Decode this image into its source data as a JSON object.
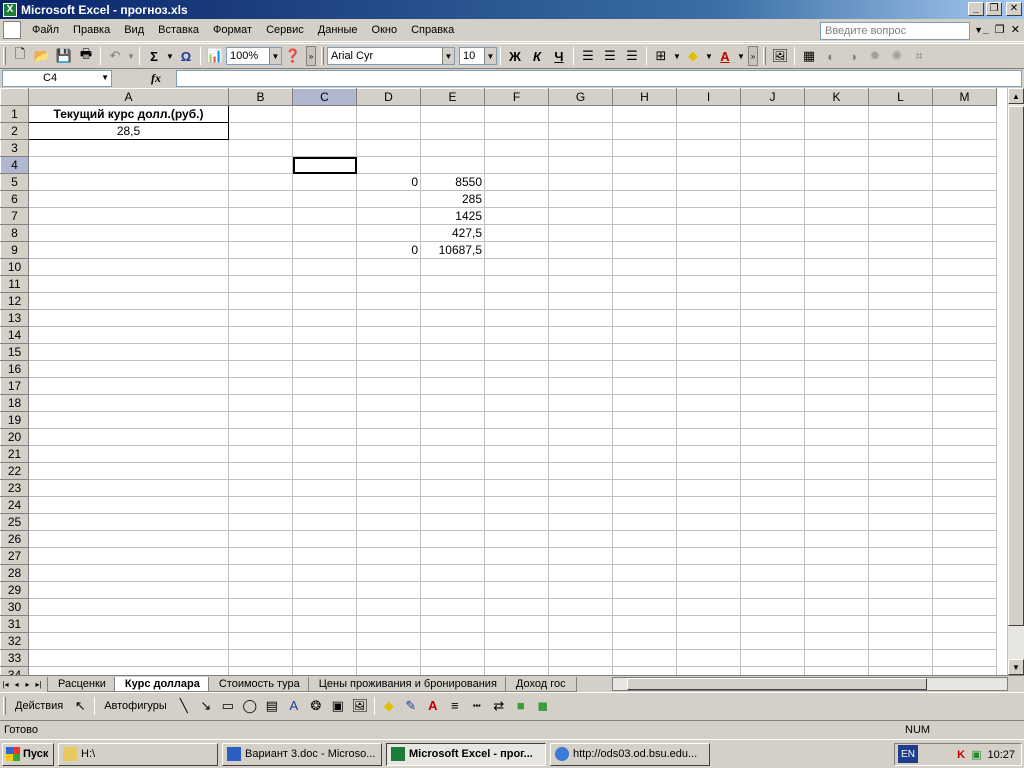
{
  "window": {
    "title": "Microsoft Excel - прогноз.xls",
    "app_icon": "excel-icon"
  },
  "menu": {
    "items": [
      "Файл",
      "Правка",
      "Вид",
      "Вставка",
      "Формат",
      "Сервис",
      "Данные",
      "Окно",
      "Справка"
    ],
    "ask_placeholder": "Введите вопрос"
  },
  "toolbar": {
    "zoom": "100%",
    "font_name": "Arial Cyr",
    "font_size": "10",
    "bold": "Ж",
    "italic": "К",
    "underline": "Ч",
    "sum": "Σ",
    "omega": "Ω"
  },
  "formula_bar": {
    "name_box": "C4",
    "fx": "fx",
    "formula": ""
  },
  "grid": {
    "columns": [
      "A",
      "B",
      "C",
      "D",
      "E",
      "F",
      "G",
      "H",
      "I",
      "J",
      "K",
      "L",
      "M"
    ],
    "selected_column": "C",
    "selected_row": 4,
    "rows": 34,
    "cells": {
      "A1": "Текущий курс долл.(руб.)",
      "A2": "28,5",
      "D5": "0",
      "E5": "8550",
      "E6": "285",
      "E7": "1425",
      "E8": "427,5",
      "D9": "0",
      "E9": "10687,5"
    }
  },
  "sheets": {
    "tabs": [
      "Расценки",
      "Курс доллара",
      "Стоимость тура",
      "Цены проживания и бронирования",
      "Доход гос"
    ],
    "active": 1
  },
  "drawing_toolbar": {
    "actions": "Действия",
    "autoshapes": "Автофигуры"
  },
  "status": {
    "ready": "Готово",
    "num": "NUM"
  },
  "taskbar": {
    "start": "Пуск",
    "buttons": [
      {
        "label": "H:\\",
        "active": false
      },
      {
        "label": "Вариант 3.doc - Microso...",
        "active": false
      },
      {
        "label": "Microsoft Excel - прог...",
        "active": true
      },
      {
        "label": "http://ods03.od.bsu.edu...",
        "active": false
      }
    ],
    "lang": "EN",
    "clock": "10:27"
  }
}
